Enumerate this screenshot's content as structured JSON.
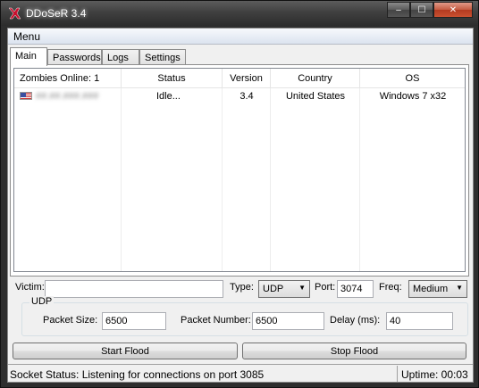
{
  "window": {
    "title": "DDoSeR 3.4",
    "minimize_glyph": "‒",
    "maximize_glyph": "☐",
    "close_glyph": "✕"
  },
  "menu": {
    "label": "Menu"
  },
  "tabs": [
    {
      "label": "Main",
      "active": true
    },
    {
      "label": "Passwords",
      "active": false
    },
    {
      "label": "Logs",
      "active": false
    },
    {
      "label": "Settings",
      "active": false
    }
  ],
  "table": {
    "headers": [
      "Zombies Online: 1",
      "Status",
      "Version",
      "Country",
      "OS"
    ],
    "rows": [
      {
        "ip": "##.##.###.###",
        "status": "Idle...",
        "version": "3.4",
        "country": "United States",
        "os": "Windows 7 x32"
      }
    ]
  },
  "controls": {
    "victim_label": "Victim:",
    "victim_value": "",
    "type_label": "Type:",
    "type_value": "UDP",
    "port_label": "Port:",
    "port_value": "3074",
    "freq_label": "Freq:",
    "freq_value": "Medium"
  },
  "udp_group": {
    "title": "UDP",
    "packet_size_label": "Packet Size:",
    "packet_size_value": "6500",
    "packet_number_label": "Packet Number:",
    "packet_number_value": "6500",
    "delay_label": "Delay (ms):",
    "delay_value": "40"
  },
  "buttons": {
    "start": "Start Flood",
    "stop": "Stop Flood"
  },
  "status": {
    "socket": "Socket Status: Listening for connections on port 3085",
    "uptime": "Uptime: 00:03"
  },
  "colors": {
    "titlebar": "#3a3a3a",
    "client_bg": "#f0f0f0",
    "icon_red": "#c8102e"
  },
  "icons": {
    "app": "ddoser-app-icon",
    "flag": "us-flag-icon"
  }
}
